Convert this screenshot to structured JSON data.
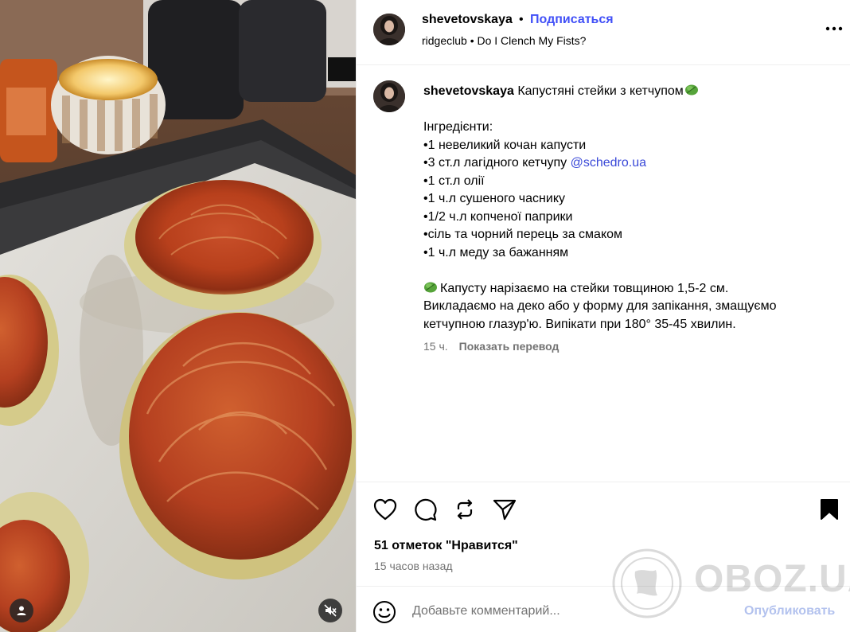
{
  "colors": {
    "accent": "#4150f7",
    "mention": "#3a49d8",
    "muted": "#737373",
    "publish_disabled": "#b3c2ee"
  },
  "header": {
    "username": "shevetovskaya",
    "separator": "•",
    "follow_label": "Подписаться",
    "subline": "ridgeclub • Do I Clench My Fists?"
  },
  "caption": {
    "username": "shevetovskaya",
    "title": "Капустяні стейки з кетчупом",
    "title_emoji": "leaf-emoji",
    "ingredients_heading": "Інгредієнти:",
    "ingredients": [
      "•1 невеликий кочан капусти",
      "•3 ст.л лагідного кетчупу ",
      "•1 ст.л олії",
      "•1 ч.л сушеного часнику",
      "•1/2 ч.л копченої паприки",
      "•сіль та чорний перець за смаком",
      "•1 ч.л меду за бажанням"
    ],
    "mention": "@schedro.ua",
    "instructions": [
      "Капусту нарізаємо на стейки товщиною 1,5-2 см.",
      "Викладаємо на деко або у форму для запікання, змащуємо",
      "кетчупною глазур'ю. Випікати при 180° 35-45 хвилин."
    ],
    "time": "15 ч.",
    "translate_label": "Показать перевод"
  },
  "actions": {
    "icons": [
      "heart-icon",
      "comment-icon",
      "repost-icon",
      "share-icon",
      "bookmark-icon"
    ],
    "likes": "51 отметок \"Нравится\"",
    "ago": "15 часов назад"
  },
  "comment": {
    "placeholder": "Добавьте комментарий...",
    "publish_label": "Опубликовать"
  },
  "watermark": {
    "text": "OBOZ.UA"
  }
}
